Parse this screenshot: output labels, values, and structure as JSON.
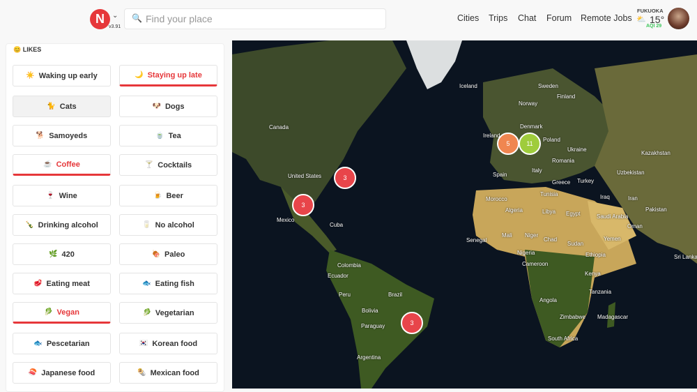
{
  "header": {
    "logo": "N",
    "version": "v3.91",
    "search_placeholder": "Find your place",
    "nav": [
      "Cities",
      "Trips",
      "Chat",
      "Forum",
      "Remote Jobs"
    ],
    "weather": {
      "city": "FUKUOKA",
      "temp": "15°",
      "aqi": "AQI 29"
    }
  },
  "likes": {
    "title": "LIKES",
    "items": [
      {
        "label": "Waking up early",
        "emoji": "☀️",
        "state": "normal"
      },
      {
        "label": "Staying up late",
        "emoji": "🌙",
        "state": "selected"
      },
      {
        "label": "Cats",
        "emoji": "🐈",
        "state": "gray"
      },
      {
        "label": "Dogs",
        "emoji": "🐶",
        "state": "normal"
      },
      {
        "label": "Samoyeds",
        "emoji": "🐕",
        "state": "normal"
      },
      {
        "label": "Tea",
        "emoji": "🍵",
        "state": "normal"
      },
      {
        "label": "Coffee",
        "emoji": "☕",
        "state": "selected"
      },
      {
        "label": "Cocktails",
        "emoji": "🍸",
        "state": "normal"
      },
      {
        "label": "Wine",
        "emoji": "🍷",
        "state": "normal"
      },
      {
        "label": "Beer",
        "emoji": "🍺",
        "state": "normal"
      },
      {
        "label": "Drinking alcohol",
        "emoji": "🍾",
        "state": "normal"
      },
      {
        "label": "No alcohol",
        "emoji": "🥛",
        "state": "normal"
      },
      {
        "label": "420",
        "emoji": "🌿",
        "state": "normal"
      },
      {
        "label": "Paleo",
        "emoji": "🍖",
        "state": "normal"
      },
      {
        "label": "Eating meat",
        "emoji": "🥩",
        "state": "normal"
      },
      {
        "label": "Eating fish",
        "emoji": "🐟",
        "state": "normal"
      },
      {
        "label": "Vegan",
        "emoji": "🥬",
        "state": "selected"
      },
      {
        "label": "Vegetarian",
        "emoji": "🥬",
        "state": "normal"
      },
      {
        "label": "Pescetarian",
        "emoji": "🐟",
        "state": "normal"
      },
      {
        "label": "Korean food",
        "emoji": "🇰🇷",
        "state": "normal"
      },
      {
        "label": "Japanese food",
        "emoji": "🍣",
        "state": "normal"
      },
      {
        "label": "Mexican food",
        "emoji": "🌯",
        "state": "normal"
      }
    ]
  },
  "map": {
    "labels": [
      "Iceland",
      "Sweden",
      "Finland",
      "Norway",
      "Canada",
      "Denmark",
      "Ireland",
      "Poland",
      "Ukraine",
      "Kazakhstan",
      "United States",
      "Spain",
      "Italy",
      "Romania",
      "Uzbekistan",
      "Greece",
      "Turkey",
      "Tunisia",
      "Morocco",
      "Algeria",
      "Libya",
      "Egypt",
      "Iraq",
      "Iran",
      "Pakistan",
      "Saudi Arabia",
      "Oman",
      "Mexico",
      "Cuba",
      "Mali",
      "Niger",
      "Chad",
      "Sudan",
      "Yemen",
      "Senegal",
      "Nigeria",
      "Ethiopia",
      "Cameroon",
      "Sri Lanka",
      "Colombia",
      "Kenya",
      "Ecuador",
      "Peru",
      "Brazil",
      "Tanzania",
      "Bolivia",
      "Angola",
      "Paraguay",
      "Zimbabwe",
      "Madagascar",
      "South Africa",
      "Argentina"
    ],
    "clusters": [
      {
        "count": "3",
        "color": "#e8454a"
      },
      {
        "count": "3",
        "color": "#e8454a"
      },
      {
        "count": "5",
        "color": "#f08650"
      },
      {
        "count": "11",
        "color": "#9fcc3c"
      },
      {
        "count": "3",
        "color": "#e8454a"
      }
    ]
  }
}
